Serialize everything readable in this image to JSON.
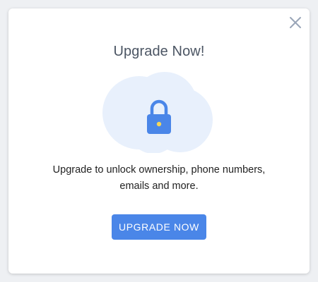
{
  "modal": {
    "title": "Upgrade Now!",
    "description_line1": "Upgrade to unlock ownership, phone numbers,",
    "description_line2": "emails and more.",
    "cta_label": "UPGRADE NOW",
    "close_icon": "close-icon",
    "illustration_icon": "lock-icon"
  },
  "colors": {
    "accent": "#4a86e8",
    "cloud": "#e8f0fc",
    "lock_body": "#4a86e8",
    "keyhole": "#f5d75a",
    "title": "#4b5563",
    "close": "#9aa6b8"
  }
}
